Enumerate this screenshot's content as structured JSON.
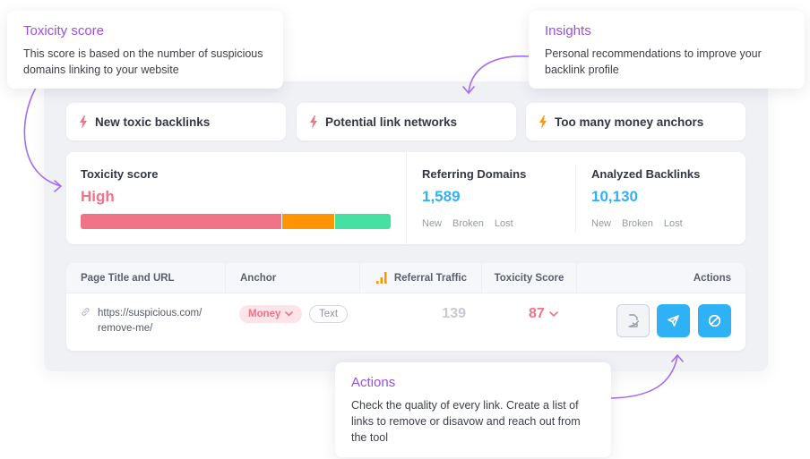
{
  "tooltips": {
    "toxicity": {
      "title": "Toxicity score",
      "body": "This score is based on the number of suspicious domains linking to your website"
    },
    "insights": {
      "title": "Insights",
      "body": "Personal recommendations to improve your backlink profile"
    },
    "actions": {
      "title": "Actions",
      "body": "Check the quality of every link. Create a list of links to remove or disavow and reach out from the tool"
    }
  },
  "alerts": [
    {
      "label": "New toxic backlinks",
      "icon": "bolt-icon",
      "color": "#f07388"
    },
    {
      "label": "Potential link networks",
      "icon": "bolt-icon",
      "color": "#f07388"
    },
    {
      "label": "Too many money anchors",
      "icon": "bolt-icon",
      "color": "#ff9505"
    }
  ],
  "metrics": {
    "toxicity": {
      "label": "Toxicity score",
      "value": "High",
      "bar": [
        {
          "level": "toxic",
          "share": 0.65,
          "color": "#f07388"
        },
        {
          "level": "potentially-toxic",
          "share": 0.17,
          "color": "#ff9505"
        },
        {
          "level": "non-toxic",
          "share": 0.18,
          "color": "#46e0a3"
        }
      ]
    },
    "referring_domains": {
      "label": "Referring Domains",
      "value": "1,589",
      "sub": [
        "New",
        "Broken",
        "Lost"
      ]
    },
    "analyzed_backlinks": {
      "label": "Analyzed Backlinks",
      "value": "10,130",
      "sub": [
        "New",
        "Broken",
        "Lost"
      ]
    }
  },
  "table": {
    "columns": [
      "Page Title and URL",
      "Anchor",
      "Referral Traffic",
      "Toxicity Score",
      "Actions"
    ],
    "rows": [
      {
        "url_line1": "https://suspicious.com/",
        "url_line2": "remove-me/",
        "anchor_type": "Money",
        "anchor_tag": "Text",
        "referral_traffic": "139",
        "toxicity_score": "87",
        "actions": [
          "review-icon",
          "send-icon",
          "disavow-icon"
        ]
      }
    ]
  },
  "colors": {
    "accent_purple": "#9a4fe0",
    "toxic": "#f07388",
    "warning": "#ff9505",
    "safe": "#46e0a3",
    "primary_blue": "#2fb1f5"
  }
}
